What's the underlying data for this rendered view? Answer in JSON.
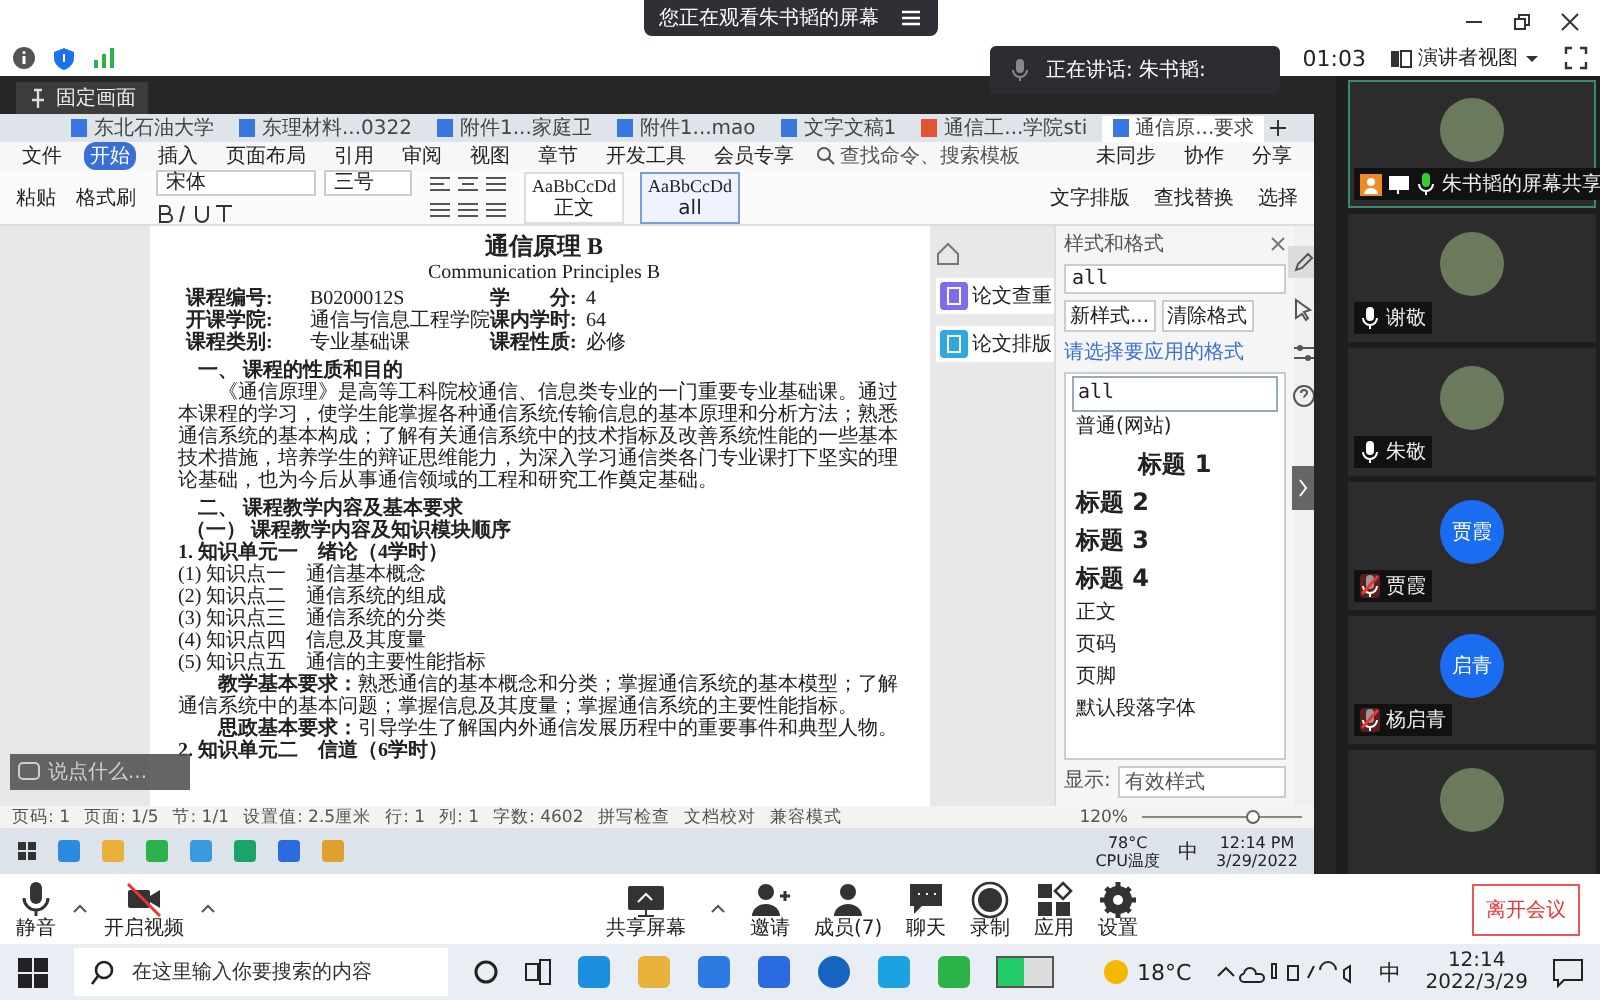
{
  "viewing_banner": {
    "text": "您正在观看朱书韬的屏幕"
  },
  "top_bar": {
    "timer": "01:03",
    "view_button": "演讲者视图"
  },
  "speaking": {
    "label": "正在讲话: 朱书韬:"
  },
  "pin_tooltip": {
    "label": "固定画面"
  },
  "shared_screen": {
    "doc_tabs": [
      {
        "label": "东北石油大学",
        "selected": false
      },
      {
        "label": "东理材料...0322",
        "selected": false
      },
      {
        "label": "附件1...家庭卫",
        "selected": false
      },
      {
        "label": "附件1...mao",
        "selected": false
      },
      {
        "label": "文字文稿1",
        "selected": false
      },
      {
        "label": "通信工...学院sti",
        "selected": false
      },
      {
        "label": "通信原...要求",
        "selected": true
      }
    ],
    "menu": [
      {
        "label": "文件",
        "selected": false
      },
      {
        "label": "开始",
        "selected": true
      },
      {
        "label": "插入",
        "selected": false
      },
      {
        "label": "页面布局",
        "selected": false
      },
      {
        "label": "引用",
        "selected": false
      },
      {
        "label": "审阅",
        "selected": false
      },
      {
        "label": "视图",
        "selected": false
      },
      {
        "label": "章节",
        "selected": false
      },
      {
        "label": "开发工具",
        "selected": false
      },
      {
        "label": "会员专享",
        "selected": false
      }
    ],
    "menu_search": {
      "placeholder": "查找命令、搜索模板"
    },
    "menu_right": [
      "未同步",
      "协作",
      "分享"
    ],
    "ribbon": {
      "left_buttons": [
        "粘贴",
        "格式刷"
      ],
      "font": "宋体",
      "size": "三号",
      "styles": [
        {
          "sample": "AaBbCcDd",
          "name": "正文",
          "selected": false
        },
        {
          "sample": "AaBbCcDd",
          "name": "all",
          "selected": true
        }
      ],
      "tools": [
        "文字排版",
        "查找替换",
        "选择"
      ]
    },
    "document": [
      {
        "kind": "title",
        "text": "通信原理 B"
      },
      {
        "kind": "subtitle",
        "text": "Communication Principles B"
      },
      {
        "kind": "info",
        "cells": [
          "课程编号:",
          "B0200012S",
          "学　　分:",
          "4"
        ]
      },
      {
        "kind": "info",
        "cells": [
          "开课学院:",
          "通信与信息工程学院",
          "课内学时:",
          "64"
        ]
      },
      {
        "kind": "info",
        "cells": [
          "课程类别:",
          "专业基础课",
          "课程性质:",
          "必修"
        ]
      },
      {
        "kind": "h1",
        "text": "一、 课程的性质和目的"
      },
      {
        "kind": "para",
        "text": "《通信原理》是高等工科院校通信、信息类专业的一门重要专业基础课。通过本课程的学习，使学生能掌握各种通信系统传输信息的基本原理和分析方法；熟悉通信系统的基本构成；了解有关通信系统中的技术指标及改善系统性能的一些基本技术措施，培养学生的辩证思维能力，为深入学习通信类各门专业课打下坚实的理论基础，也为今后从事通信领域的工程和研究工作奠定基础。"
      },
      {
        "kind": "h1",
        "text": "二、 课程教学内容及基本要求"
      },
      {
        "kind": "h2",
        "text": "（一） 课程教学内容及知识模块顺序"
      },
      {
        "kind": "h3",
        "text": "1. 知识单元一　绪论（4学时）"
      },
      {
        "kind": "item",
        "text": "(1) 知识点一　通信基本概念"
      },
      {
        "kind": "item",
        "text": "(2) 知识点二　通信系统的组成"
      },
      {
        "kind": "item",
        "text": "(3) 知识点三　通信系统的分类"
      },
      {
        "kind": "item",
        "text": "(4) 知识点四　信息及其度量"
      },
      {
        "kind": "item",
        "text": "(5) 知识点五　通信的主要性能指标"
      },
      {
        "kind": "para",
        "text": "**教学基本要求：**熟悉通信的基本概念和分类；掌握通信系统的基本模型；了解通信系统中的基本问题；掌握信息及其度量；掌握通信系统的主要性能指标。"
      },
      {
        "kind": "para",
        "text": "**思政基本要求：**引导学生了解国内外通信发展历程中的重要事件和典型人物。"
      },
      {
        "kind": "h3",
        "text": "2. 知识单元二　信道（6学时）"
      }
    ],
    "side_tools": [
      "论文查重",
      "论文排版"
    ],
    "style_panel": {
      "title": "样式和格式",
      "current": "all",
      "buttons": [
        "新样式...",
        "清除格式"
      ],
      "hint": "请选择要应用的格式",
      "styles": [
        {
          "kind": "plain",
          "name": "all",
          "selected": true
        },
        {
          "kind": "plain",
          "name": "普通(网站)",
          "selected": false
        },
        {
          "kind": "h1",
          "name": "标题 1",
          "selected": false
        },
        {
          "kind": "h2",
          "name": "标题 2",
          "selected": false
        },
        {
          "kind": "h2",
          "name": "标题 3",
          "selected": false
        },
        {
          "kind": "h2",
          "name": "标题 4",
          "selected": false
        },
        {
          "kind": "plain",
          "name": "正文",
          "selected": false
        },
        {
          "kind": "plain",
          "name": "页码",
          "selected": false
        },
        {
          "kind": "plain",
          "name": "页脚",
          "selected": false
        },
        {
          "kind": "plain",
          "name": "默认段落字体",
          "selected": false
        }
      ],
      "show_label": "显示:",
      "show_value": "有效样式"
    },
    "status_bar": {
      "items": [
        "页码: 1",
        "页面: 1/5",
        "节: 1/1",
        "设置值: 2.5厘米",
        "行: 1",
        "列: 1",
        "字数: 4602",
        "拼写检查",
        "文档校对",
        "兼容模式"
      ],
      "zoom": "120%",
      "zoom_slider": {
        "level": 0.7
      }
    },
    "taskbar": {
      "cpu_temp": "78°C",
      "cpu_label": "CPU温度",
      "ime": "中",
      "time": "12:14 PM",
      "date": "3/29/2022"
    }
  },
  "chat_input": {
    "placeholder": "说点什么..."
  },
  "participants": [
    {
      "kind": "photo",
      "name": "朱书韬的屏幕共享",
      "speaking": true,
      "muted": false
    },
    {
      "kind": "photo",
      "name": "谢敬",
      "speaking": false,
      "muted": false
    },
    {
      "kind": "photo",
      "name": "朱敬",
      "speaking": false,
      "muted": false
    },
    {
      "kind": "initials",
      "avatar_text": "贾霞",
      "name": "贾霞",
      "speaking": false,
      "muted": true
    },
    {
      "kind": "initials",
      "avatar_text": "启青",
      "name": "杨启青",
      "speaking": false,
      "muted": true
    },
    {
      "kind": "photo",
      "speaking": false
    }
  ],
  "toolbar": [
    "静音",
    "开启视频",
    "共享屏幕",
    "邀请",
    "成员(7)",
    "聊天",
    "录制",
    "应用",
    "设置"
  ],
  "leave_button": "离开会议",
  "win_taskbar": {
    "search_placeholder": "在这里输入你要搜索的内容",
    "weather": "18°C",
    "ime": "中",
    "time": "12:14",
    "date": "2022/3/29"
  }
}
